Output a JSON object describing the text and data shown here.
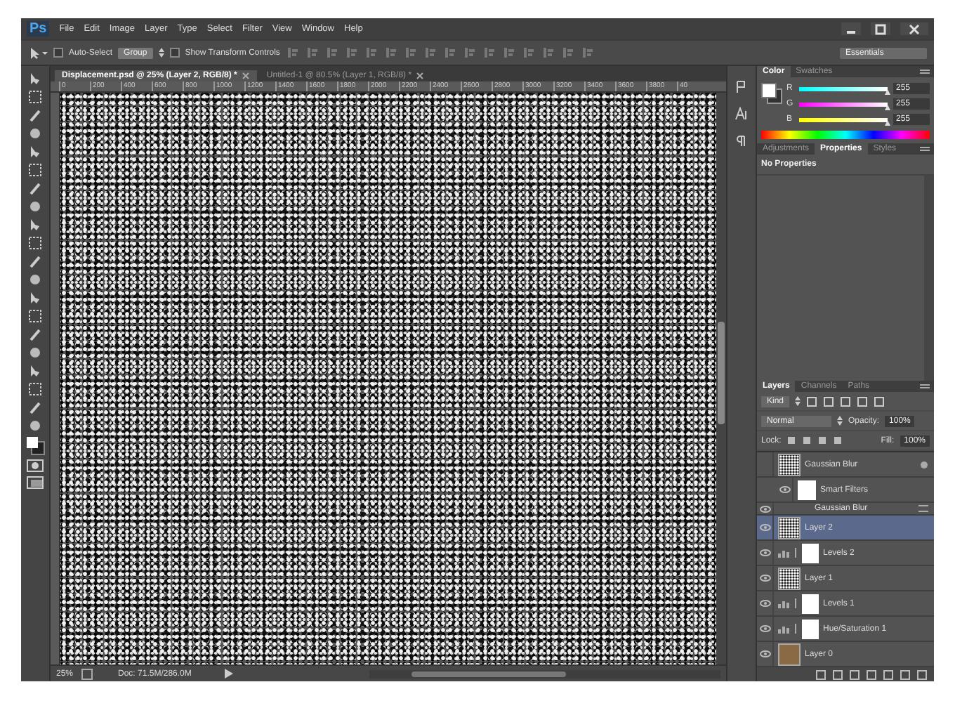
{
  "app": {
    "logo": "Ps",
    "menus": [
      "File",
      "Edit",
      "Image",
      "Layer",
      "Type",
      "Select",
      "Filter",
      "View",
      "Window",
      "Help"
    ]
  },
  "options_bar": {
    "auto_select": {
      "label": "Auto-Select",
      "checked": false
    },
    "group_select": "Group",
    "transform_controls": {
      "label": "Show Transform Controls",
      "checked": false
    },
    "workspace": "Essentials"
  },
  "documents": [
    {
      "title": "Displacement.psd @ 25% (Layer 2, RGB/8) *",
      "selected": true
    },
    {
      "title": "Untitled-1 @ 80.5% (Layer 1, RGB/8) *",
      "selected": false
    }
  ],
  "ruler_marks": [
    "0",
    "200",
    "400",
    "600",
    "800",
    "1000",
    "1200",
    "1400",
    "1600",
    "1800",
    "2000",
    "2200",
    "2400",
    "2600",
    "2800",
    "3000",
    "3200",
    "3400",
    "3600",
    "3800",
    "40"
  ],
  "status_bar": {
    "zoom": "25%",
    "doc_size": "Doc: 71.5M/286.0M"
  },
  "color_panel": {
    "tabs": [
      {
        "label": "Color",
        "selected": true
      },
      {
        "label": "Swatches",
        "selected": false
      }
    ],
    "channels": [
      {
        "label": "R",
        "level": 1,
        "value": "255"
      },
      {
        "label": "G",
        "level": 1,
        "value": "255"
      },
      {
        "label": "B",
        "level": 1,
        "value": "255"
      }
    ]
  },
  "properties_panel": {
    "tabs": [
      {
        "label": "Adjustments",
        "selected": false
      },
      {
        "label": "Properties",
        "selected": true
      },
      {
        "label": "Styles",
        "selected": false
      }
    ],
    "message": "No Properties"
  },
  "layers_panel": {
    "tabs": [
      {
        "label": "Layers",
        "selected": true
      },
      {
        "label": "Channels",
        "selected": false
      },
      {
        "label": "Paths",
        "selected": false
      }
    ],
    "filter_kind": "Kind",
    "blend_mode": "Normal",
    "opacity_label": "Opacity:",
    "opacity": "100%",
    "lock_label": "Lock:",
    "fill_label": "Fill:",
    "fill": "100%",
    "layers": [
      {
        "name": "Gaussian Blur",
        "kind": "smart",
        "visible": false,
        "selected": false
      },
      {
        "name": "Smart Filters",
        "kind": "filter-mask",
        "visible": true,
        "selected": false
      },
      {
        "name": "Gaussian Blur",
        "kind": "filter",
        "visible": true,
        "selected": false
      },
      {
        "name": "Layer 2",
        "kind": "pixel",
        "visible": true,
        "selected": true
      },
      {
        "name": "Levels 2",
        "kind": "adjustment",
        "visible": true,
        "selected": false
      },
      {
        "name": "Layer 1",
        "kind": "pixel",
        "visible": true,
        "selected": false
      },
      {
        "name": "Levels 1",
        "kind": "adjustment",
        "visible": true,
        "selected": false
      },
      {
        "name": "Hue/Saturation 1",
        "kind": "adjustment",
        "visible": true,
        "selected": false
      },
      {
        "name": "Layer 0",
        "kind": "image",
        "visible": true,
        "selected": false
      }
    ]
  }
}
